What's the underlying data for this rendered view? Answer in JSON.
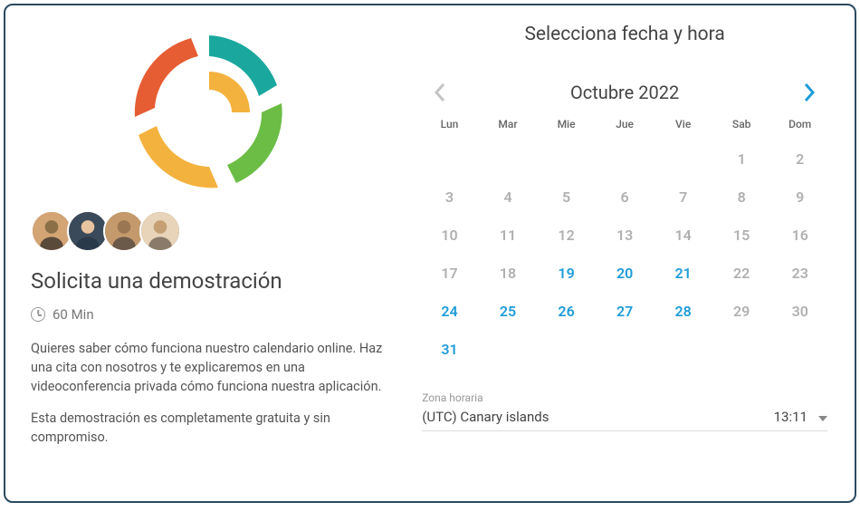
{
  "left": {
    "title": "Solicita una demostración",
    "duration": "60 Min",
    "description_p1": "Quieres saber cómo funciona nuestro calendario online. Haz una cita con nosotros y te explicaremos en una videoconferencia privada cómo funciona nuestra aplicación.",
    "description_p2": "Esta demostración es completamente gratuita y sin compromiso."
  },
  "right": {
    "title": "Selecciona fecha y hora",
    "month": "Octubre 2022",
    "weekdays": [
      "Lun",
      "Mar",
      "Mie",
      "Jue",
      "Vie",
      "Sab",
      "Dom"
    ],
    "days": [
      {
        "n": "",
        "state": "empty"
      },
      {
        "n": "",
        "state": "empty"
      },
      {
        "n": "",
        "state": "empty"
      },
      {
        "n": "",
        "state": "empty"
      },
      {
        "n": "",
        "state": "empty"
      },
      {
        "n": "1",
        "state": "disabled"
      },
      {
        "n": "2",
        "state": "disabled"
      },
      {
        "n": "3",
        "state": "disabled"
      },
      {
        "n": "4",
        "state": "disabled"
      },
      {
        "n": "5",
        "state": "disabled"
      },
      {
        "n": "6",
        "state": "disabled"
      },
      {
        "n": "7",
        "state": "disabled"
      },
      {
        "n": "8",
        "state": "disabled"
      },
      {
        "n": "9",
        "state": "disabled"
      },
      {
        "n": "10",
        "state": "disabled"
      },
      {
        "n": "11",
        "state": "disabled"
      },
      {
        "n": "12",
        "state": "disabled"
      },
      {
        "n": "13",
        "state": "disabled"
      },
      {
        "n": "14",
        "state": "disabled"
      },
      {
        "n": "15",
        "state": "disabled"
      },
      {
        "n": "16",
        "state": "disabled"
      },
      {
        "n": "17",
        "state": "disabled"
      },
      {
        "n": "18",
        "state": "disabled"
      },
      {
        "n": "19",
        "state": "available"
      },
      {
        "n": "20",
        "state": "available"
      },
      {
        "n": "21",
        "state": "available"
      },
      {
        "n": "22",
        "state": "disabled"
      },
      {
        "n": "23",
        "state": "disabled"
      },
      {
        "n": "24",
        "state": "available"
      },
      {
        "n": "25",
        "state": "available"
      },
      {
        "n": "26",
        "state": "available"
      },
      {
        "n": "27",
        "state": "available"
      },
      {
        "n": "28",
        "state": "available"
      },
      {
        "n": "29",
        "state": "disabled"
      },
      {
        "n": "30",
        "state": "disabled"
      },
      {
        "n": "31",
        "state": "available"
      }
    ],
    "timezone_label": "Zona horaria",
    "timezone_value": "(UTC) Canary islands",
    "timezone_time": "13:11"
  },
  "colors": {
    "accent": "#1e9cd8",
    "logo_orange": "#e65d33",
    "logo_teal": "#1aa89e",
    "logo_yellow": "#f3b23e",
    "logo_green": "#6bbd45"
  }
}
